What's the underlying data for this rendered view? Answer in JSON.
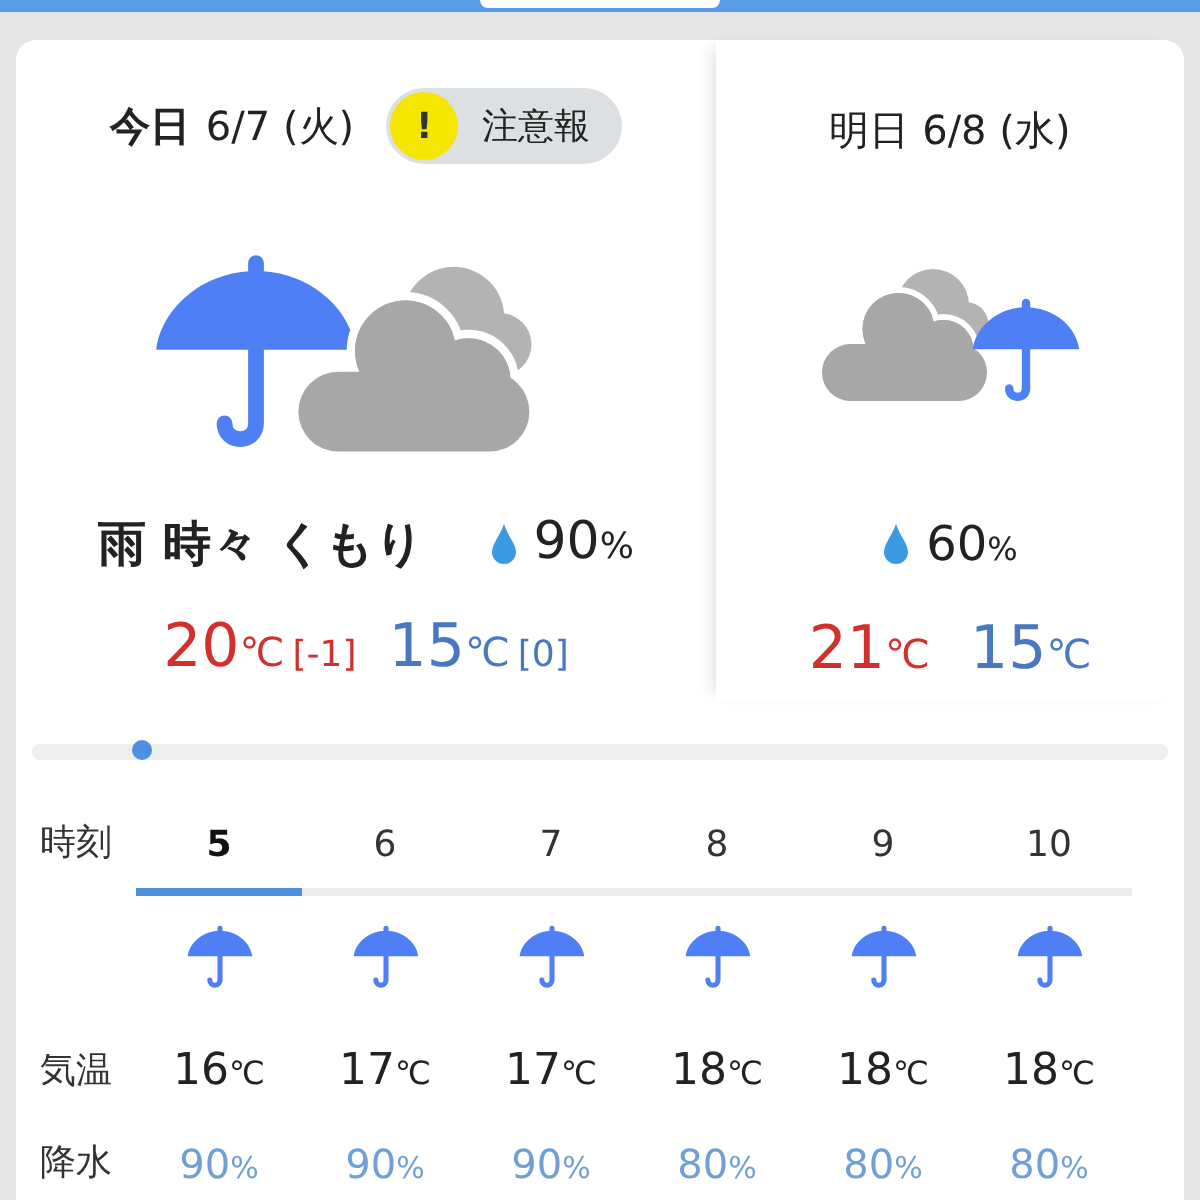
{
  "today": {
    "day": "今日",
    "date": "6/7 (火)",
    "alert": {
      "icon": "!",
      "label": "注意報"
    },
    "weather": "雨 時々 くもり",
    "precip": "90",
    "precip_unit": "%",
    "high": {
      "value": "20",
      "unit": "℃",
      "diff": "[-1]"
    },
    "low": {
      "value": "15",
      "unit": "℃",
      "diff": "[0]"
    }
  },
  "tomorrow": {
    "label": "明日 6/8 (水)",
    "precip": "60",
    "precip_unit": "%",
    "high": {
      "value": "21",
      "unit": "℃"
    },
    "low": {
      "value": "15",
      "unit": "℃"
    }
  },
  "hourly": {
    "row_labels": {
      "time": "時刻",
      "temp": "気温",
      "precip": "降水"
    },
    "hours": [
      {
        "time": "5",
        "selected": true,
        "temp": "16",
        "temp_unit": "℃",
        "precip": "90",
        "precip_unit": "%"
      },
      {
        "time": "6",
        "selected": false,
        "temp": "17",
        "temp_unit": "℃",
        "precip": "90",
        "precip_unit": "%"
      },
      {
        "time": "7",
        "selected": false,
        "temp": "17",
        "temp_unit": "℃",
        "precip": "90",
        "precip_unit": "%"
      },
      {
        "time": "8",
        "selected": false,
        "temp": "18",
        "temp_unit": "℃",
        "precip": "80",
        "precip_unit": "%"
      },
      {
        "time": "9",
        "selected": false,
        "temp": "18",
        "temp_unit": "℃",
        "precip": "80",
        "precip_unit": "%"
      },
      {
        "time": "10",
        "selected": false,
        "temp": "18",
        "temp_unit": "℃",
        "precip": "80",
        "precip_unit": "%"
      }
    ]
  }
}
